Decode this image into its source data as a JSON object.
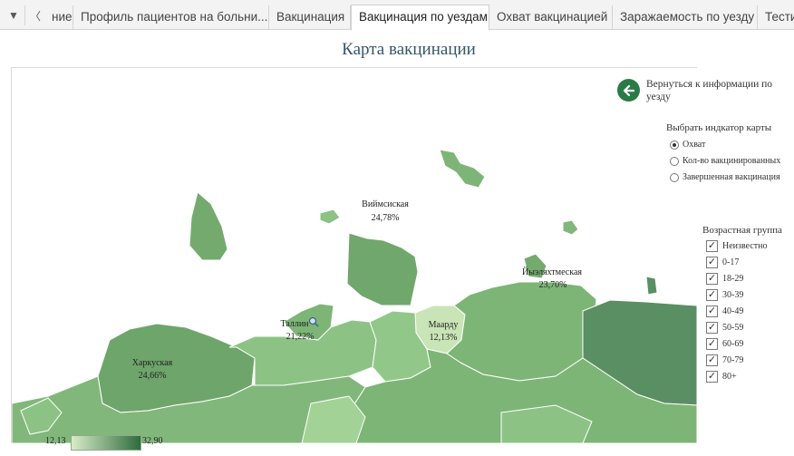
{
  "tabs": {
    "nav_menu": "▼",
    "nav_prev": "〈",
    "items": [
      {
        "label": "ние"
      },
      {
        "label": "Профиль пациентов на больни..."
      },
      {
        "label": "Вакцинация"
      },
      {
        "label": "Вакцинация по уездам"
      },
      {
        "label": "Охват вакцинацией"
      },
      {
        "label": "Заражаемость по уезду"
      },
      {
        "label": "Тести"
      }
    ],
    "active": "Вакцинация по уездам"
  },
  "page": {
    "title": "Карта вакцинации"
  },
  "map": {
    "labels": [
      {
        "name": "Виймсиская",
        "value": "24,78%"
      },
      {
        "name": "Таллин",
        "value": "21,22%"
      },
      {
        "name": "Маарду",
        "value": "12,13%"
      },
      {
        "name": "Йыэляхтмеская",
        "value": "23,70%"
      },
      {
        "name": "Харкуская",
        "value": "24,66%"
      }
    ],
    "legend": {
      "min": "12,13",
      "max": "32,90"
    },
    "colors": {
      "light": "#d8ecc6",
      "mid": "#82b77b",
      "dark": "#5a8f64"
    }
  },
  "sidebar": {
    "back_text": "Вернуться к информации по уезду",
    "indicator_title": "Выбрать индкатор карты",
    "indicators": [
      {
        "label": "Охват",
        "selected": true
      },
      {
        "label": "Кол-во вакцинированных",
        "selected": false
      },
      {
        "label": "Завершенная вакцинация",
        "selected": false
      }
    ],
    "age_title": "Возрастная группа",
    "age_groups": [
      "Неизвестно",
      "0-17",
      "18-29",
      "30-39",
      "40-49",
      "50-59",
      "60-69",
      "70-79",
      "80+"
    ]
  }
}
